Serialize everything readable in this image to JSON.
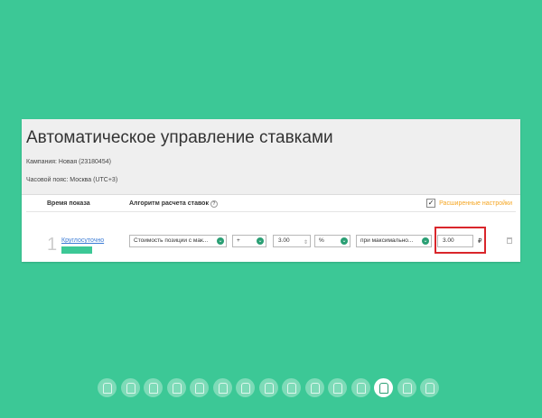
{
  "title": "Автоматическое управление ставками",
  "campaign": "Кампания: Новая (23180454)",
  "timezone": "Часовой пояс: Москва (UTC+3)",
  "columns": {
    "time": "Время показа",
    "algorithm": "Алгоритм расчета ставок"
  },
  "advanced": {
    "label": "Расширенные настройки",
    "checked": true
  },
  "row": {
    "number": "1",
    "time_value": "Круглосуточно",
    "strategy": "Стоимость позиции с мак...",
    "operator": "+",
    "value": "3.00",
    "unit": "%",
    "condition": "при максимально...",
    "max_bid": "3.00",
    "currency": "₽"
  },
  "pager": {
    "count": 15,
    "active_index": 12
  },
  "colors": {
    "background": "#3cc896",
    "accent": "#2a9f74",
    "highlight": "#d9262b",
    "advanced": "#f5a623"
  }
}
